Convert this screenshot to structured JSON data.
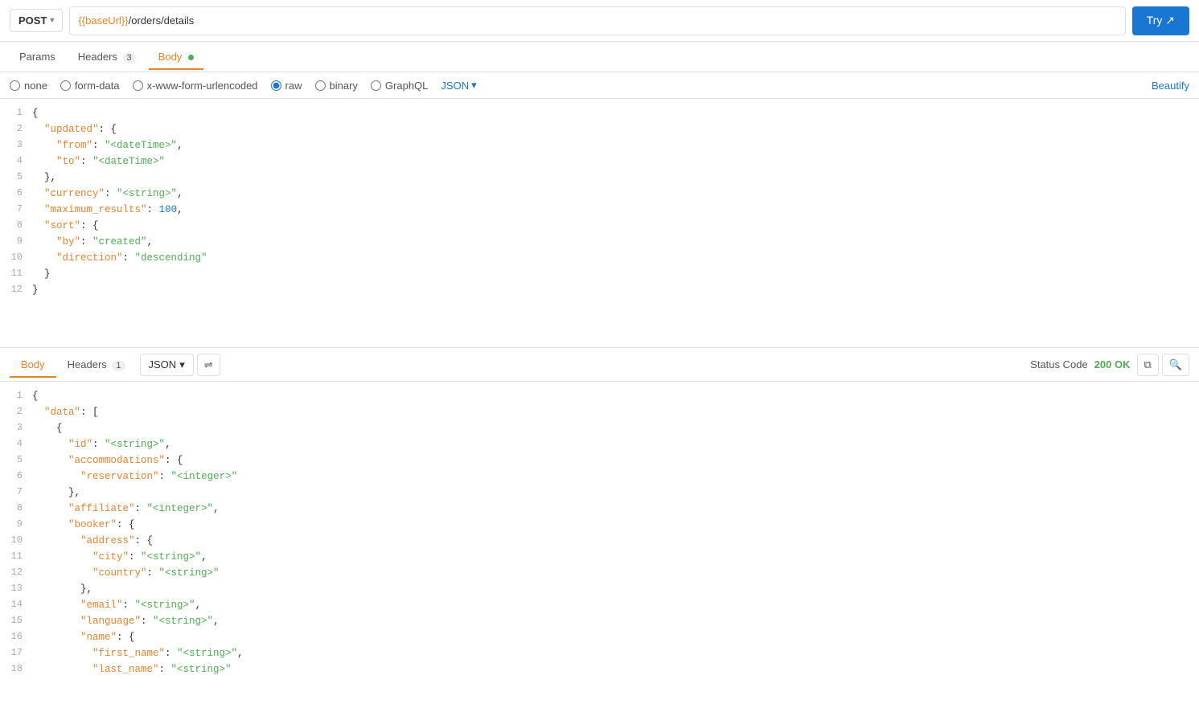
{
  "topbar": {
    "method": "POST",
    "url_base": "{{baseUrl}}",
    "url_path": "/orders/details",
    "try_label": "Try ↗"
  },
  "request_tabs": [
    {
      "id": "params",
      "label": "Params",
      "badge": null,
      "dot": false
    },
    {
      "id": "headers",
      "label": "Headers",
      "badge": "3",
      "dot": false
    },
    {
      "id": "body",
      "label": "Body",
      "badge": null,
      "dot": true
    }
  ],
  "body_options": [
    {
      "id": "none",
      "label": "none",
      "checked": false
    },
    {
      "id": "form-data",
      "label": "form-data",
      "checked": false
    },
    {
      "id": "x-www-form-urlencoded",
      "label": "x-www-form-urlencoded",
      "checked": false
    },
    {
      "id": "raw",
      "label": "raw",
      "checked": true
    },
    {
      "id": "binary",
      "label": "binary",
      "checked": false
    },
    {
      "id": "graphql",
      "label": "GraphQL",
      "checked": false
    }
  ],
  "json_label": "JSON",
  "beautify_label": "Beautify",
  "request_body_lines": [
    {
      "num": "1",
      "content": "{"
    },
    {
      "num": "2",
      "content": "  \"updated\": {"
    },
    {
      "num": "3",
      "content": "    \"from\": \"<dateTime>\","
    },
    {
      "num": "4",
      "content": "    \"to\": \"<dateTime>\""
    },
    {
      "num": "5",
      "content": "  },"
    },
    {
      "num": "6",
      "content": "  \"currency\": \"<string>\","
    },
    {
      "num": "7",
      "content": "  \"maximum_results\": 100,"
    },
    {
      "num": "8",
      "content": "  \"sort\": {"
    },
    {
      "num": "9",
      "content": "    \"by\": \"created\","
    },
    {
      "num": "10",
      "content": "    \"direction\": \"descending\""
    },
    {
      "num": "11",
      "content": "  }"
    },
    {
      "num": "12",
      "content": "}"
    }
  ],
  "response_tabs": [
    {
      "id": "body",
      "label": "Body",
      "active": true
    },
    {
      "id": "headers",
      "label": "Headers",
      "badge": "1",
      "active": false
    }
  ],
  "response_format": "JSON",
  "status_code_label": "Status Code",
  "status_value": "200 OK",
  "response_body_lines": [
    {
      "num": "1",
      "content": "{"
    },
    {
      "num": "2",
      "content": "  \"data\": ["
    },
    {
      "num": "3",
      "content": "    {"
    },
    {
      "num": "4",
      "content": "      \"id\": \"<string>\","
    },
    {
      "num": "5",
      "content": "      \"accommodations\": {"
    },
    {
      "num": "6",
      "content": "        \"reservation\": \"<integer>\""
    },
    {
      "num": "7",
      "content": "      },"
    },
    {
      "num": "8",
      "content": "      \"affiliate\": \"<integer>\","
    },
    {
      "num": "9",
      "content": "      \"booker\": {"
    },
    {
      "num": "10",
      "content": "        \"address\": {"
    },
    {
      "num": "11",
      "content": "          \"city\": \"<string>\","
    },
    {
      "num": "12",
      "content": "          \"country\": \"<string>\""
    },
    {
      "num": "13",
      "content": "        },"
    },
    {
      "num": "14",
      "content": "        \"email\": \"<string>\","
    },
    {
      "num": "15",
      "content": "        \"language\": \"<string>\","
    },
    {
      "num": "16",
      "content": "        \"name\": {"
    },
    {
      "num": "17",
      "content": "          \"first_name\": \"<string>\","
    },
    {
      "num": "18",
      "content": "          \"last_name\": \"<string>\""
    }
  ]
}
